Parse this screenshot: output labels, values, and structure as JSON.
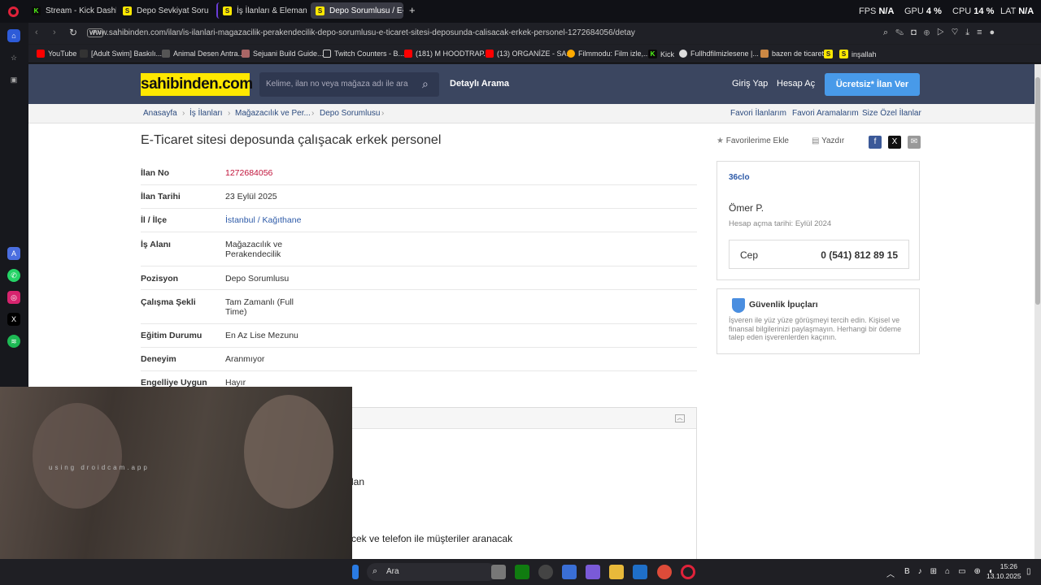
{
  "browser": {
    "tabs": [
      {
        "label": "Stream - Kick Dashboard",
        "icon": "kick-icon"
      },
      {
        "label": "Depo Sevkiyat Sorumlusu",
        "icon": "sahibinden-icon"
      },
      {
        "label": "İş İlanları & Eleman Araya",
        "icon": "sahibinden-icon"
      },
      {
        "label": "Depo Sorumlusu / E-Tica",
        "icon": "sahibinden-icon"
      }
    ],
    "new_tab": "+",
    "stats": [
      {
        "name": "FPS",
        "value": "N/A"
      },
      {
        "name": "GPU",
        "value": "4 %"
      },
      {
        "name": "CPU",
        "value": "14 %"
      },
      {
        "name": "LAT",
        "value": "N/A"
      }
    ],
    "vpn": "VPN",
    "url": "www.sahibinden.com/ilan/is-ilanlari-magazacilik-perakendecilik-depo-sorumlusu-e-ticaret-sitesi-deposunda-calisacak-erkek-personel-1272684056/detay",
    "bookmarks": [
      "YouTube",
      "[Adult Swim] Baskılı...",
      "Animal Desen Antra...",
      "Sejuani Build Guide...",
      "Twitch Counters - B...",
      "(181) M HOODTRAP...",
      "(13) ORGANİZE - SA...",
      "Filmmodu: Film izle,...",
      "Kick",
      "Fullhdfilmizlesene |...",
      "bazen de ticaret",
      "S",
      "inşallah"
    ]
  },
  "site": {
    "logo": "sahibinden.com",
    "search_placeholder": "Kelime, ilan no veya mağaza adı ile ara",
    "detailed_search": "Detaylı Arama",
    "login": "Giriş Yap",
    "register": "Hesap Aç",
    "post_ad": "Ücretsiz* İlan Ver",
    "breadcrumb": [
      "Anasayfa",
      "İş İlanları",
      "Mağazacılık ve Per...",
      "Depo Sorumlusu"
    ],
    "top_links": [
      "Favori İlanlarım",
      "Favori Aramalarım",
      "Size Özel İlanlar"
    ]
  },
  "listing": {
    "title": "E-Ticaret sitesi deposunda çalışacak erkek personel",
    "add_favorite": "Favorilerime Ekle",
    "print": "Yazdır",
    "details": [
      {
        "label": "İlan No",
        "value": "1272684056"
      },
      {
        "label": "İlan Tarihi",
        "value": "23 Eylül 2025"
      },
      {
        "label": "İl / İlçe",
        "value": "İstanbul / Kağıthane"
      },
      {
        "label": "İş Alanı",
        "value": "Mağazacılık ve Perakendecilik"
      },
      {
        "label": "Pozisyon",
        "value": "Depo Sorumlusu"
      },
      {
        "label": "Çalışma Şekli",
        "value": "Tam Zamanlı (Full Time)"
      },
      {
        "label": "Eğitim Durumu",
        "value": "En Az Lise Mezunu"
      },
      {
        "label": "Deneyim",
        "value": "Aranmıyor"
      },
      {
        "label": "Engelliye Uygun",
        "value": "Hayır"
      }
    ],
    "description_fragments": [
      "lan",
      "cek ve telefon ile müşteriler aranacak"
    ]
  },
  "seller": {
    "store": "36clo",
    "name": "Ömer P.",
    "since": "Hesap açma tarihi: Eylül 2024",
    "phone_label": "Cep",
    "phone": "0 (541) 812 89 15"
  },
  "safety": {
    "title": "Güvenlik İpuçları",
    "text": "İşveren ile yüz yüze görüşmeyi tercih edin. Kişisel ve finansal bilgilerinizi paylaşmayın. Herhangi bir ödeme talep eden işverenlerden kaçının."
  },
  "webcam": {
    "watermark": "using droidcam.app"
  },
  "taskbar": {
    "search": "Ara",
    "time": "15:26",
    "date": "13.10.2025"
  },
  "colors": {
    "header": "#3b4660",
    "logo": "#ffe800",
    "cta": "#489ae9",
    "accent_red": "#c0133a"
  }
}
